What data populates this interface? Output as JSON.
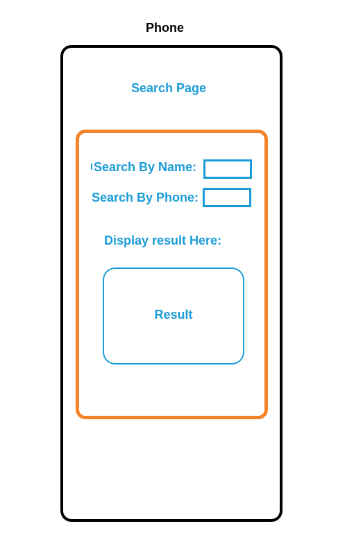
{
  "diagram": {
    "caption": "Phone",
    "page_title": "Search Page",
    "search": {
      "name_label": "Search By Name:",
      "phone_label": "Search By Phone:",
      "name_value": "",
      "phone_value": ""
    },
    "display_label": "Display result Here:",
    "result_text": "Result"
  },
  "colors": {
    "phone_frame": "#000000",
    "container_border": "#f5832a",
    "accent": "#1b9cd8"
  }
}
